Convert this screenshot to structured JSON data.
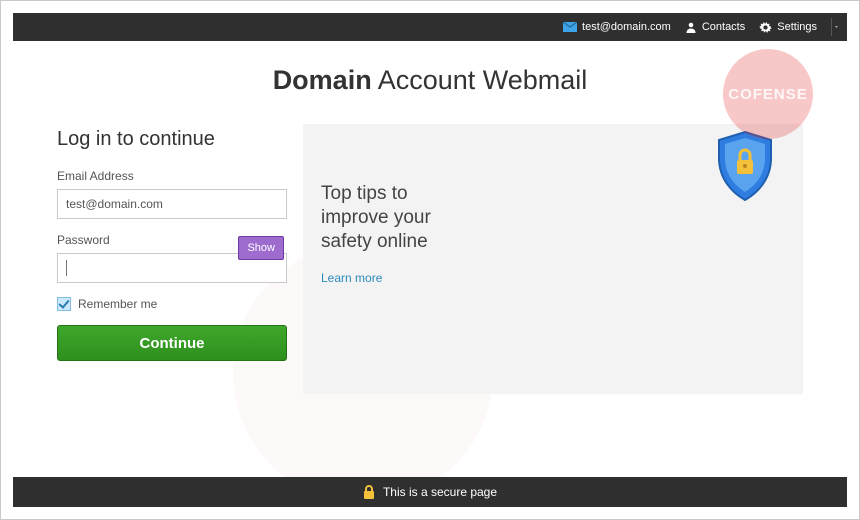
{
  "header": {
    "user_email": "test@domain.com",
    "contacts_label": "Contacts",
    "settings_label": "Settings"
  },
  "brand": {
    "title_bold": "Domain",
    "title_rest": " Account Webmail",
    "watermark_text": "COFENSE"
  },
  "login": {
    "heading": "Log in to continue",
    "email_label": "Email Address",
    "email_value": "test@domain.com",
    "password_label": "Password",
    "password_value": "",
    "show_button": "Show",
    "remember_label": "Remember me",
    "remember_checked": true,
    "continue_label": "Continue"
  },
  "tips": {
    "heading": "Top tips to improve your safety online",
    "learn_more": "Learn more"
  },
  "footer": {
    "secure_text": "This is a secure page"
  },
  "colors": {
    "accent_green": "#3fa72c",
    "accent_purple": "#9d6cce",
    "brand_red": "#e5383c",
    "link_blue": "#2a8bbd"
  }
}
